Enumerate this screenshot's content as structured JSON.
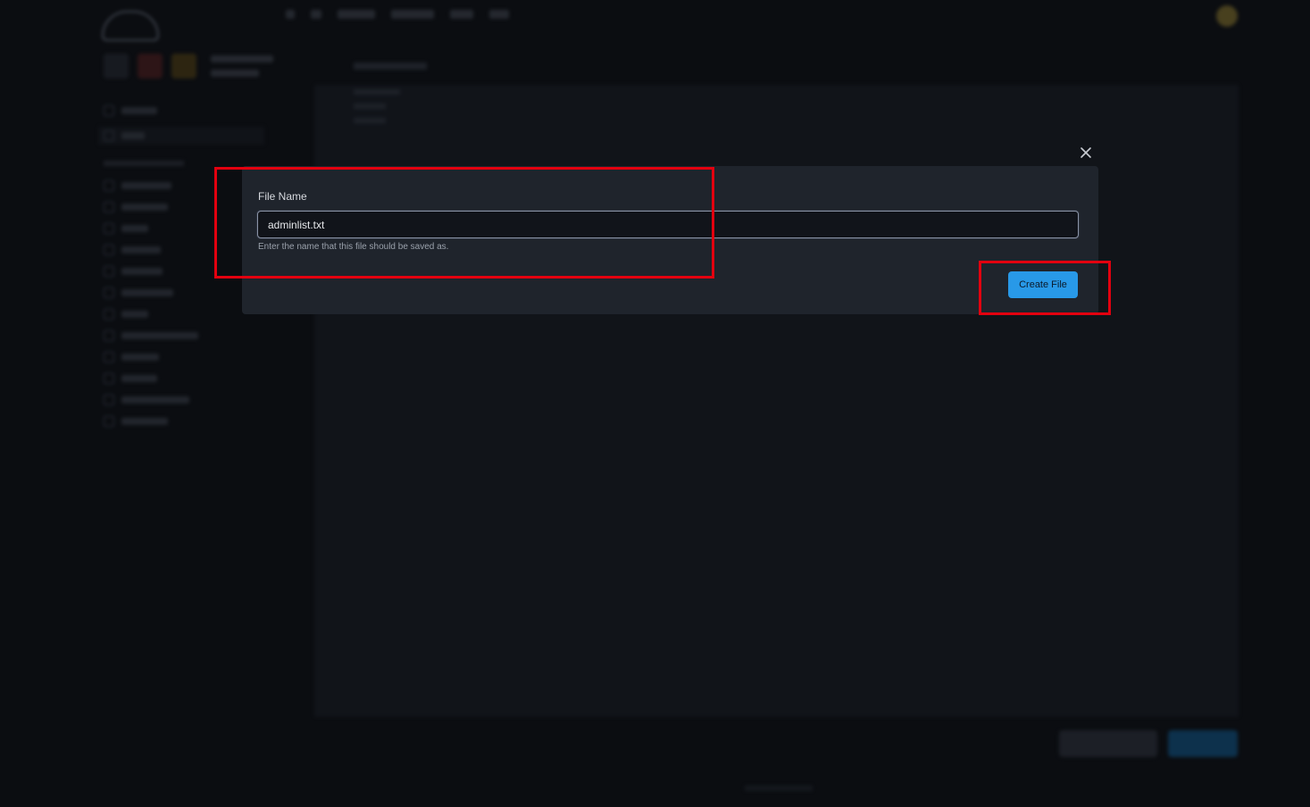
{
  "modal": {
    "field_label": "File Name",
    "file_name_value": "adminlist.txt",
    "helper_text": "Enter the name that this file should be saved as.",
    "create_button_label": "Create File"
  },
  "icons": {
    "close": "close-icon"
  },
  "colors": {
    "annotation": "#e3000f",
    "primary_button": "#2899e8",
    "modal_background": "#1f242c"
  }
}
